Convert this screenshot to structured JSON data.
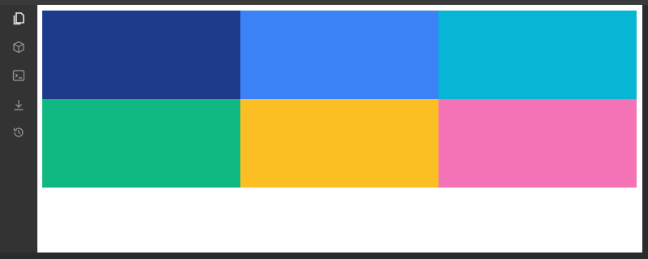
{
  "sidebar": {
    "items": [
      {
        "icon": "files-icon"
      },
      {
        "icon": "package-icon"
      },
      {
        "icon": "terminal-icon"
      },
      {
        "icon": "download-icon"
      },
      {
        "icon": "history-icon"
      }
    ]
  },
  "preview": {
    "swatches": [
      {
        "color": "#1e3a8a"
      },
      {
        "color": "#3b82f6"
      },
      {
        "color": "#06b6d4"
      },
      {
        "color": "#10b981"
      },
      {
        "color": "#fbbf24"
      },
      {
        "color": "#f472b6"
      }
    ]
  }
}
